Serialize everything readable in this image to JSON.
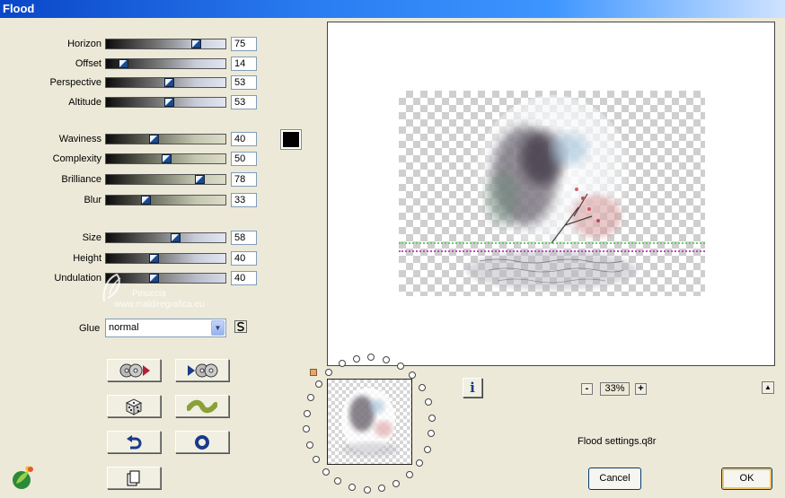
{
  "window": {
    "title": "Flood"
  },
  "sliders": [
    {
      "key": "horizon",
      "label": "Horizon",
      "value": "75",
      "fraction": 0.75,
      "style": "grey"
    },
    {
      "key": "offset",
      "label": "Offset",
      "value": "14",
      "fraction": 0.14,
      "style": "grey"
    },
    {
      "key": "perspective",
      "label": "Perspective",
      "value": "53",
      "fraction": 0.53,
      "style": "grey"
    },
    {
      "key": "altitude",
      "label": "Altitude",
      "value": "53",
      "fraction": 0.53,
      "style": "grey"
    },
    {
      "key": "waviness",
      "label": "Waviness",
      "value": "40",
      "fraction": 0.4,
      "style": "olive"
    },
    {
      "key": "complexity",
      "label": "Complexity",
      "value": "50",
      "fraction": 0.5,
      "style": "olive"
    },
    {
      "key": "brilliance",
      "label": "Brilliance",
      "value": "78",
      "fraction": 0.78,
      "style": "olive"
    },
    {
      "key": "blur",
      "label": "Blur",
      "value": "33",
      "fraction": 0.33,
      "style": "olive"
    },
    {
      "key": "size",
      "label": "Size",
      "value": "58",
      "fraction": 0.58,
      "style": "grey"
    },
    {
      "key": "height",
      "label": "Height",
      "value": "40",
      "fraction": 0.4,
      "style": "grey"
    },
    {
      "key": "undulation",
      "label": "Undulation",
      "value": "40",
      "fraction": 0.4,
      "style": "ghost"
    }
  ],
  "color_swatch": {
    "color": "#000000"
  },
  "glue": {
    "label": "Glue",
    "value": "normal"
  },
  "watermark": {
    "line1": "Pinuccia",
    "line2": "www.maldiregrafica.eu"
  },
  "toolbar_icons": [
    "open-settings-icon",
    "save-settings-icon",
    "randomize-dice-icon",
    "wave-preset-icon",
    "reset-arrow-icon",
    "loop-ring-icon",
    "copy-page-icon"
  ],
  "zoom": {
    "minus": "-",
    "value": "33%",
    "plus": "+"
  },
  "info": {
    "label": "i"
  },
  "settings_file": "Flood settings.q8r",
  "buttons": {
    "cancel": "Cancel",
    "ok": "OK"
  },
  "colors": {
    "title_start": "#0a46c8",
    "title_end": "#cfe3ff",
    "dialog_bg": "#ece9d8",
    "thumb": "#1a4a8c"
  }
}
